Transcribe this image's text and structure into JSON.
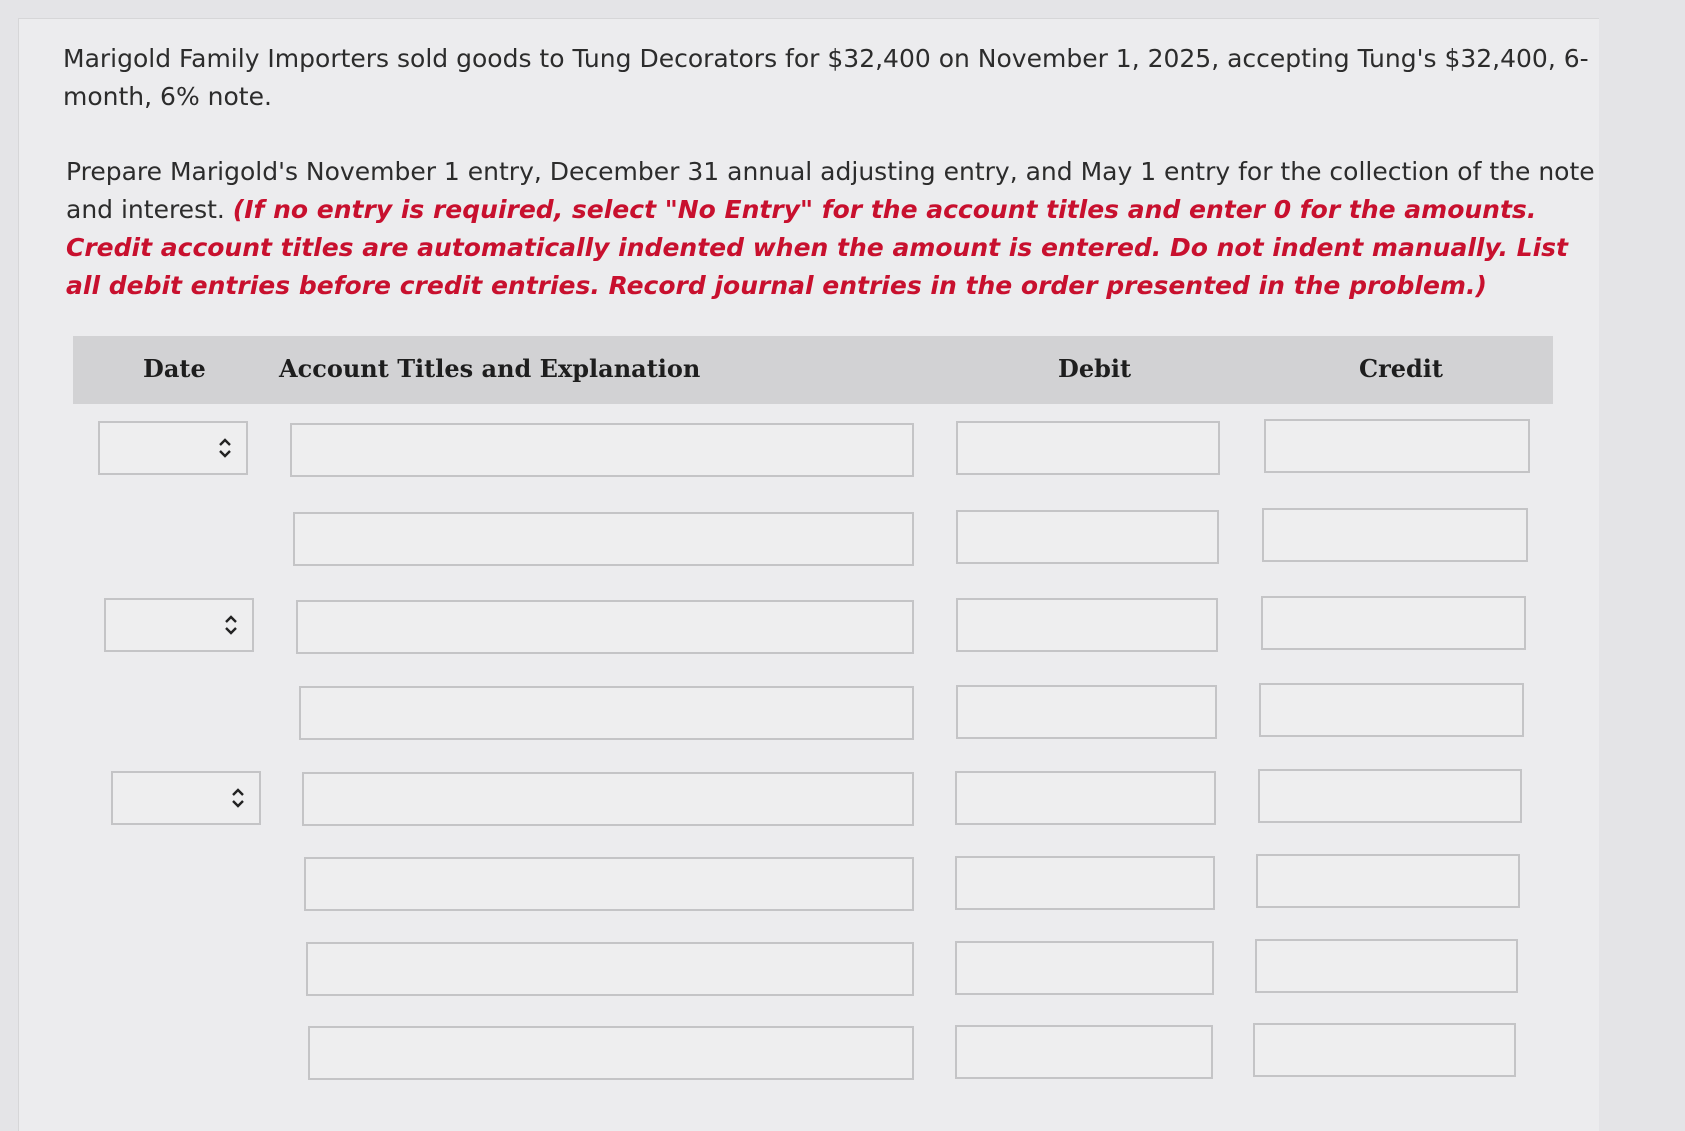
{
  "problem": {
    "statement": "Marigold Family Importers sold goods to Tung Decorators for $32,400 on November 1, 2025, accepting Tung's $32,400, 6-month, 6% note.",
    "instructions": "Prepare Marigold's November 1 entry, December 31 annual adjusting entry, and May 1 entry for the collection of the note and interest.",
    "note": "(If no entry is required, select \"No Entry\" for the account titles and enter 0 for the amounts. Credit account titles are automatically indented when the amount is entered. Do not indent manually. List all debit entries before credit entries. Record journal entries in the order presented in the problem.)"
  },
  "table": {
    "headers": {
      "date": "Date",
      "account": "Account Titles and Explanation",
      "debit": "Debit",
      "credit": "Credit"
    }
  },
  "icons": {
    "date_select": "up-down-chevron-icon"
  },
  "colors": {
    "note_text": "#c8102e",
    "header_bg": "#d2d2d4"
  }
}
